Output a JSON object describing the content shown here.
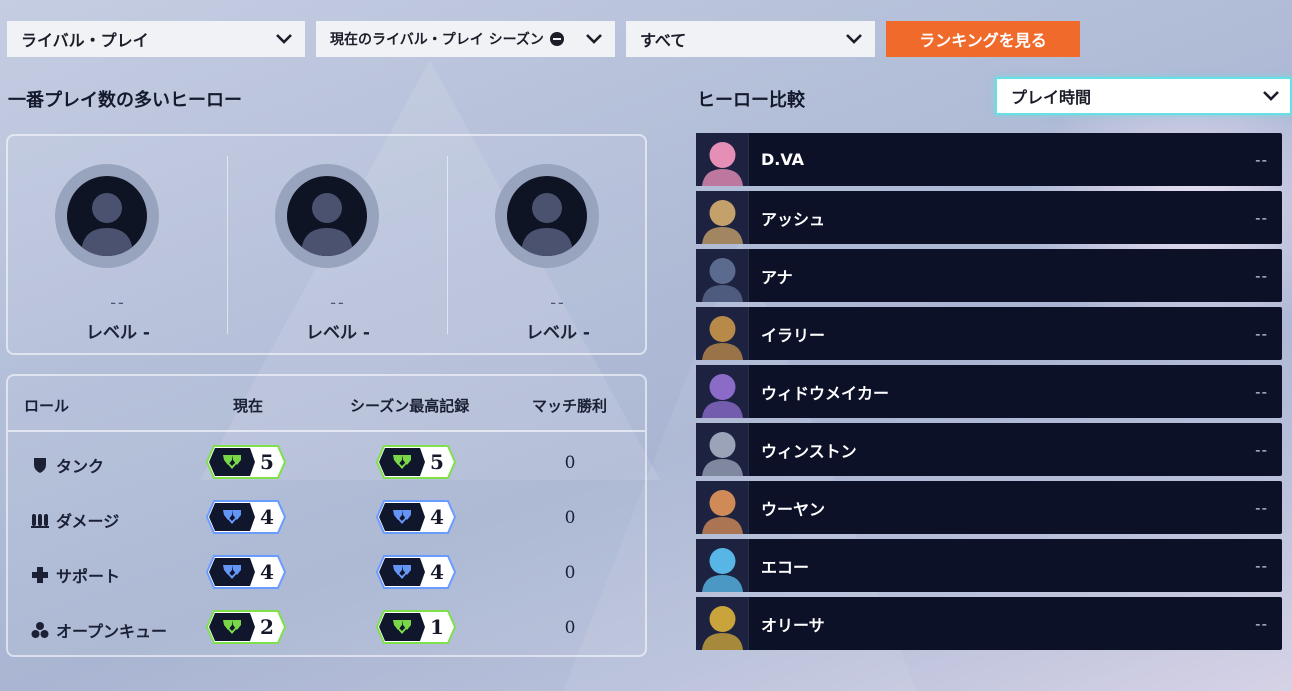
{
  "toolbar": {
    "mode": "ライバル・プレイ",
    "season": "現在のライバル・プレイ シーズン",
    "filter": "すべて",
    "ranking_button": "ランキングを見る"
  },
  "most_played": {
    "title": "一番プレイ数の多いヒーロー",
    "heroes": [
      {
        "name": "--",
        "level": "レベル -"
      },
      {
        "name": "--",
        "level": "レベル -"
      },
      {
        "name": "--",
        "level": "レベル -"
      }
    ]
  },
  "roles": {
    "headers": {
      "role": "ロール",
      "current": "現在",
      "season_best": "シーズン最高記録",
      "wins": "マッチ勝利"
    },
    "rows": [
      {
        "name": "タンク",
        "icon": "shield-icon",
        "current": "5",
        "current_tier": "green",
        "best": "5",
        "best_tier": "green",
        "wins": "0"
      },
      {
        "name": "ダメージ",
        "icon": "bullets-icon",
        "current": "4",
        "current_tier": "blue",
        "best": "4",
        "best_tier": "blue",
        "wins": "0"
      },
      {
        "name": "サポート",
        "icon": "cross-icon",
        "current": "4",
        "current_tier": "blue",
        "best": "4",
        "best_tier": "blue",
        "wins": "0"
      },
      {
        "name": "オープンキュー",
        "icon": "open-queue-icon",
        "current": "2",
        "current_tier": "green",
        "best": "1",
        "best_tier": "green",
        "wins": "0"
      }
    ]
  },
  "compare": {
    "title": "ヒーロー比較",
    "metric": "プレイ時間",
    "heroes": [
      {
        "name": "D.VA",
        "value": "--",
        "color": "#e58fb7"
      },
      {
        "name": "アッシュ",
        "value": "--",
        "color": "#c4a06a"
      },
      {
        "name": "アナ",
        "value": "--",
        "color": "#5b6a8f"
      },
      {
        "name": "イラリー",
        "value": "--",
        "color": "#b88a4a"
      },
      {
        "name": "ウィドウメイカー",
        "value": "--",
        "color": "#8a6bc8"
      },
      {
        "name": "ウィンストン",
        "value": "--",
        "color": "#9aa3b8"
      },
      {
        "name": "ウーヤン",
        "value": "--",
        "color": "#d08a58"
      },
      {
        "name": "エコー",
        "value": "--",
        "color": "#58b6e6"
      },
      {
        "name": "オリーサ",
        "value": "--",
        "color": "#c9a43a"
      }
    ]
  },
  "colors": {
    "accent_orange": "#f06a2c",
    "row_bg": "#0d1128",
    "tier_green": "#7ee04a",
    "tier_blue": "#6a9cff",
    "select_glow": "#66e0e6"
  }
}
